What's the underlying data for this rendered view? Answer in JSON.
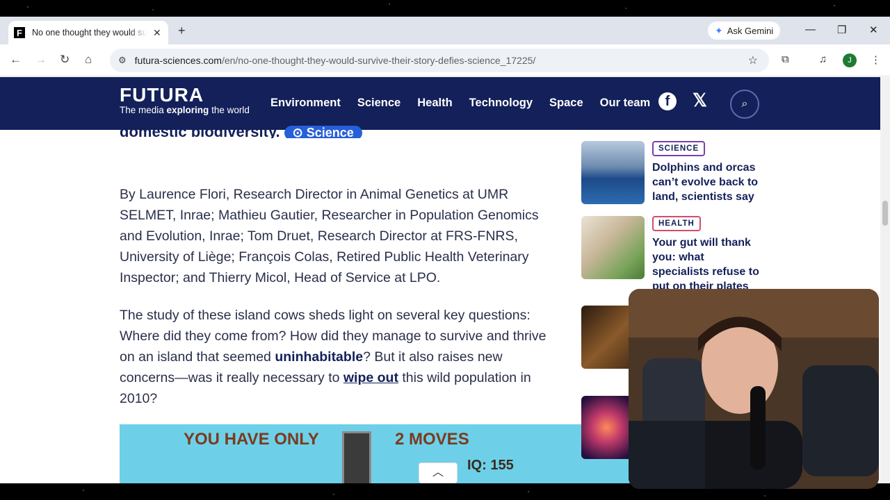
{
  "browser": {
    "tab_title": "No one thought they would survive their story defies science",
    "tab_favicon": "F",
    "ask_gemini": "Ask Gemini",
    "url_domain": "futura-sciences.com",
    "url_path": "/en/no-one-thought-they-would-survive-their-story-defies-science_17225/",
    "profile_initial": "J"
  },
  "site": {
    "brand": "FUTURA",
    "tagline_pre": "The media ",
    "tagline_bold": "exploring",
    "tagline_post": " the world",
    "nav": [
      "Environment",
      "Science",
      "Health",
      "Technology",
      "Space",
      "Our team"
    ]
  },
  "article": {
    "cut_heading": "domestic biodiversity.",
    "cut_pill": "⊙ Science",
    "byline": "By Laurence Flori, Research Director in Animal Genetics at UMR SELMET, Inrae; Mathieu Gautier, Researcher in Population Genomics and Evolution, Inrae; Tom Druet, Research Director at FRS-FNRS, University of Liège; François Colas, Retired Public Health Veterinary Inspector; and Thierry Micol, Head of Service at LPO.",
    "p1": "The study of these island cows sheds light on several key questions: Where did they come from? How did they manage to survive and thrive on an island that seemed ",
    "p1_bold": "uninhabitable",
    "p1_mid": "? But it also raises new concerns—was it really necessary to ",
    "p1_link": "wipe out",
    "p1_end": " this wild population in 2010?"
  },
  "ad": {
    "text_left": "YOU HAVE ONLY",
    "text_right": "2 MOVES",
    "iq": "IQ: 155"
  },
  "sidebar": {
    "cards": [
      {
        "badge": "SCIENCE",
        "title": "Dolphins and orcas can’t evolve back to land, scientists say"
      },
      {
        "badge": "HEALTH",
        "title": "Your gut will thank you: what specialists refuse to put on their plates"
      }
    ]
  },
  "colors": {
    "header_bg": "#13205a",
    "science_badge": "#7a3fb2",
    "health_badge": "#d44a6b",
    "pill_bg": "#2660d8"
  }
}
